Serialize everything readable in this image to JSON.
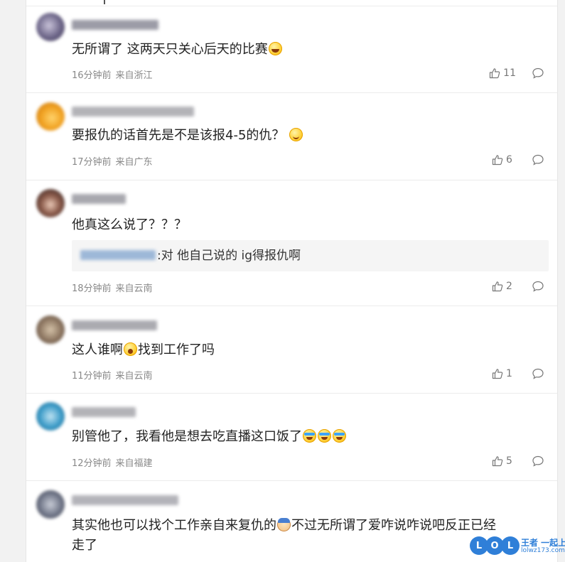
{
  "comments": [
    {
      "text": "无所谓了 这两天只关心后天的比赛",
      "emoji": [
        "laugh-icon"
      ],
      "time": "16分钟前",
      "location": "来自浙江",
      "likes": "11"
    },
    {
      "text": "要报仇的话首先是不是该报4-5的仇？",
      "emoji": [
        "smile-icon"
      ],
      "time": "17分钟前",
      "location": "来自广东",
      "likes": "6"
    },
    {
      "text": "他真这么说了？？？",
      "quote": ":对 他自己说的 ig得报仇啊",
      "time": "18分钟前",
      "location": "来自云南",
      "likes": "2"
    },
    {
      "text_before": "这人谁啊",
      "emoji": [
        "shock-icon"
      ],
      "text_after": "找到工作了吗",
      "time": "11分钟前",
      "location": "来自云南",
      "likes": "1"
    },
    {
      "text": "别管他了，我看他是想去吃直播这口饭了",
      "emoji": [
        "cry-icon",
        "cry-icon",
        "cry-icon"
      ],
      "time": "12分钟前",
      "location": "来自福建",
      "likes": "5"
    },
    {
      "text_before": "其实他也可以找个工作亲自来复仇的",
      "emoji": [
        "face-icon"
      ],
      "text_after": "不过无所谓了爱咋说咋说吧反正已经走了"
    }
  ],
  "watermark": {
    "ring_letters": [
      "L",
      "O",
      "L"
    ],
    "title": "王者 一起上",
    "url": "lolwz173.com"
  },
  "colors": {
    "meta_text": "#888888",
    "comment_text": "#222222",
    "quote_bg": "#f5f5f5",
    "watermark_blue": "#2f7fd8"
  }
}
